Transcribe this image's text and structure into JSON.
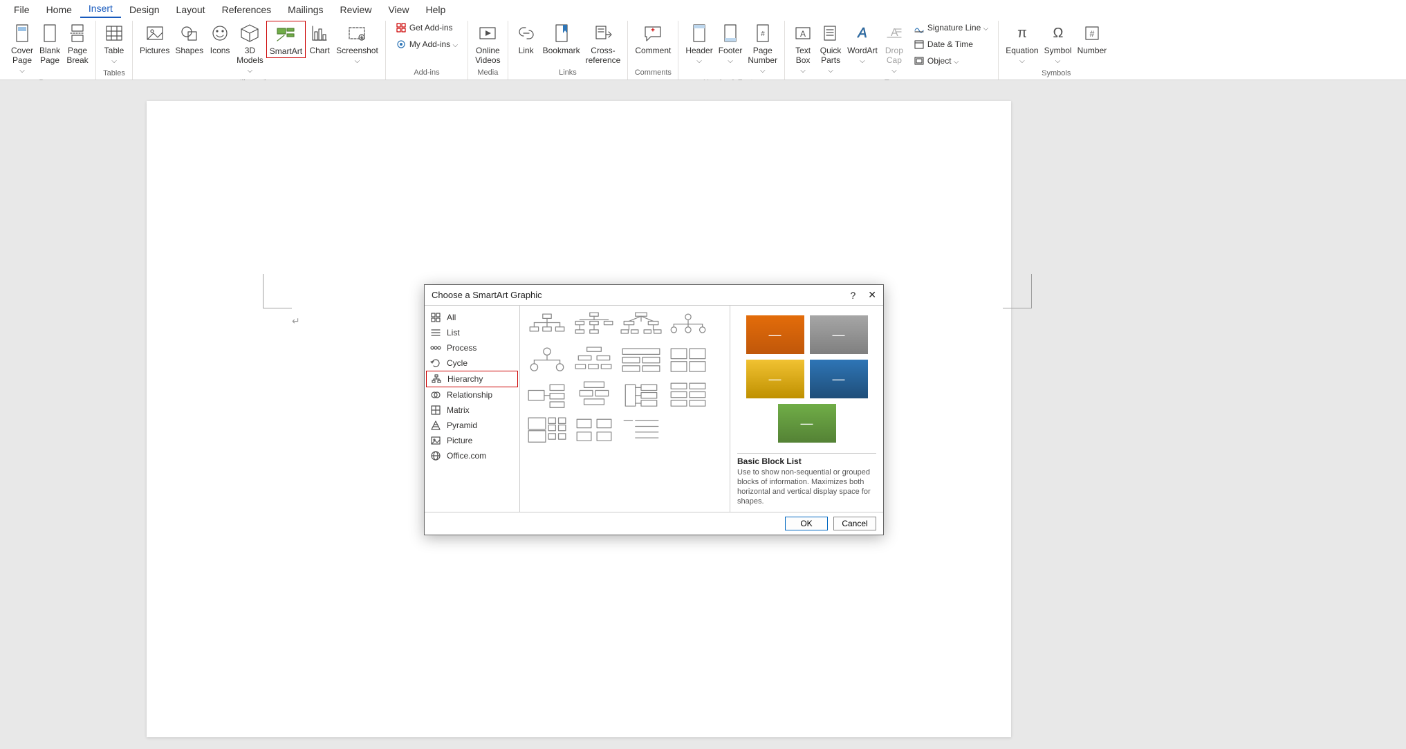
{
  "tabs": [
    "File",
    "Home",
    "Insert",
    "Design",
    "Layout",
    "References",
    "Mailings",
    "Review",
    "View",
    "Help"
  ],
  "active_tab_index": 2,
  "ribbon": {
    "pages": {
      "label": "Pages",
      "cover": "Cover\nPage",
      "blank": "Blank\nPage",
      "break": "Page\nBreak"
    },
    "tables": {
      "label": "Tables",
      "table": "Table"
    },
    "illus": {
      "label": "Illustrations",
      "pictures": "Pictures",
      "shapes": "Shapes",
      "icons": "Icons",
      "models": "3D\nModels",
      "smartart": "SmartArt",
      "chart": "Chart",
      "screenshot": "Screenshot"
    },
    "addins": {
      "label": "Add-ins",
      "get": "Get Add-ins",
      "my": "My Add-ins"
    },
    "media": {
      "label": "Media",
      "video": "Online\nVideos"
    },
    "links": {
      "label": "Links",
      "link": "Link",
      "bookmark": "Bookmark",
      "xref": "Cross-\nreference"
    },
    "comments": {
      "label": "Comments",
      "comment": "Comment"
    },
    "hf": {
      "label": "Header & Footer",
      "header": "Header",
      "footer": "Footer",
      "pagenum": "Page\nNumber"
    },
    "text": {
      "label": "Text",
      "textbox": "Text\nBox",
      "quick": "Quick\nParts",
      "wordart": "WordArt",
      "dropcap": "Drop\nCap",
      "sig": "Signature Line",
      "date": "Date & Time",
      "obj": "Object"
    },
    "symbols": {
      "label": "Symbols",
      "equation": "Equation",
      "symbol": "Symbol",
      "number": "Number"
    }
  },
  "dialog": {
    "title": "Choose a SmartArt Graphic",
    "help": "?",
    "close": "✕",
    "categories": [
      "All",
      "List",
      "Process",
      "Cycle",
      "Hierarchy",
      "Relationship",
      "Matrix",
      "Pyramid",
      "Picture",
      "Office.com"
    ],
    "highlight_cat_index": 4,
    "preview": {
      "title": "Basic Block List",
      "desc": "Use to show non-sequential or grouped blocks of information. Maximizes both horizontal and vertical display space for shapes.",
      "blocks": [
        {
          "bg": "linear-gradient(#e36c0a,#c0570a)"
        },
        {
          "bg": "linear-gradient(#a6a6a6,#7f7f7f)"
        },
        {
          "bg": "linear-gradient(#f1c232,#bf9000)"
        },
        {
          "bg": "linear-gradient(#2e75b6,#1f4e79)"
        },
        {
          "bg": "linear-gradient(#70ad47,#548235)"
        }
      ]
    },
    "ok": "OK",
    "cancel": "Cancel"
  }
}
